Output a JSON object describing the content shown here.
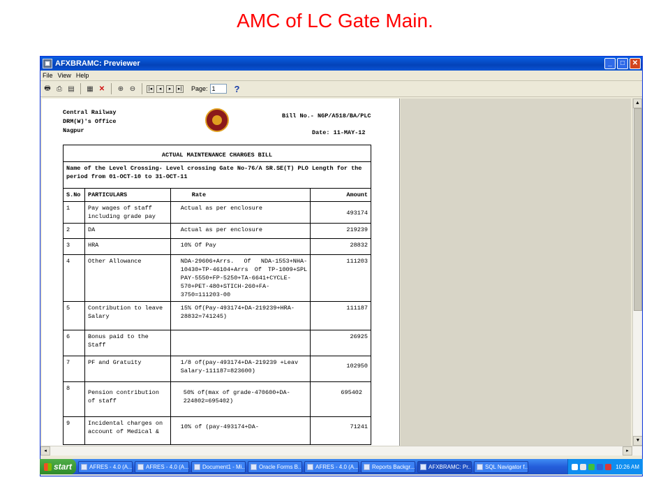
{
  "slide": {
    "title": "AMC of LC Gate Main."
  },
  "window": {
    "title": "AFXBRAMC: Previewer",
    "menu": [
      "File",
      "View",
      "Help"
    ],
    "toolbar": {
      "page_label": "Page:",
      "page_value": "1",
      "help": "?"
    }
  },
  "report": {
    "header_left": [
      "Central Railway",
      "DRM(W)'s Office",
      "Nagpur"
    ],
    "bill_no": "Bill No.- NGP/A518/BA/PLC",
    "date": "Date:  11-MAY-12",
    "table_title": "ACTUAL MAINTENANCE CHARGES BILL",
    "description": "Name of the Level Crossing- Level crossing Gate No-76/A SR.SE(T) PLO Length for the period from 01-OCT-10 to 31-OCT-11",
    "columns": [
      "S.No",
      "PARTICULARS",
      "Rate",
      "Amount"
    ],
    "rows": [
      {
        "sno": "1",
        "particulars": "Pay wages of staff including grade pay",
        "rate": "Actual as per enclosure",
        "amount": "493174"
      },
      {
        "sno": "2",
        "particulars": "DA",
        "rate": "Actual as per enclosure",
        "amount": "219239"
      },
      {
        "sno": "3",
        "particulars": "HRA",
        "rate": "10% Of Pay",
        "amount": "28832"
      },
      {
        "sno": "4",
        "particulars": "Other Allowance",
        "rate": "NDA-29606+Arrs. Of NDA-1553+NHA-10430+TP-46104+Arrs Of TP-1009+SPL PAY-5550+FP-5250+TA-6641+CYCLE-570+PET-480+STICH-260+FA-3750=111203-00",
        "amount": "111203"
      },
      {
        "sno": "5",
        "particulars": "Contribution to leave Salary",
        "rate": "15% Of(Pay-493174+DA-219239+HRA-28832=741245)",
        "amount": "111187"
      },
      {
        "sno": "6",
        "particulars": "Bonus paid to the Staff",
        "rate": "",
        "amount": "26925"
      },
      {
        "sno": "7",
        "particulars": "PF and Gratuity",
        "rate": "1/8 of(pay-493174+DA-219239 +Leav Salary-111187=823600)",
        "amount": "102950"
      },
      {
        "sno": "8",
        "particulars": "Pension contribution of staff",
        "rate": "50% of(max of grade-470600+DA-224802=695402)",
        "amount": "695402"
      },
      {
        "sno": "9",
        "particulars": "Incidental charges on account of Medical &",
        "rate": "10% of (pay-493174+DA-",
        "amount": "71241"
      }
    ]
  },
  "taskbar": {
    "start": "start",
    "tasks": [
      "AFRES - 4.0 (A...",
      "AFRES - 4.0 (A...",
      "Document1 - Mi...",
      "Oracle Forms B...",
      "AFRES - 4.0 (A...",
      "Reports Backgr...",
      "AFXBRAMC: Pr...",
      "SQL Navigator f..."
    ],
    "active_index": 6,
    "time": "10:26 AM"
  }
}
